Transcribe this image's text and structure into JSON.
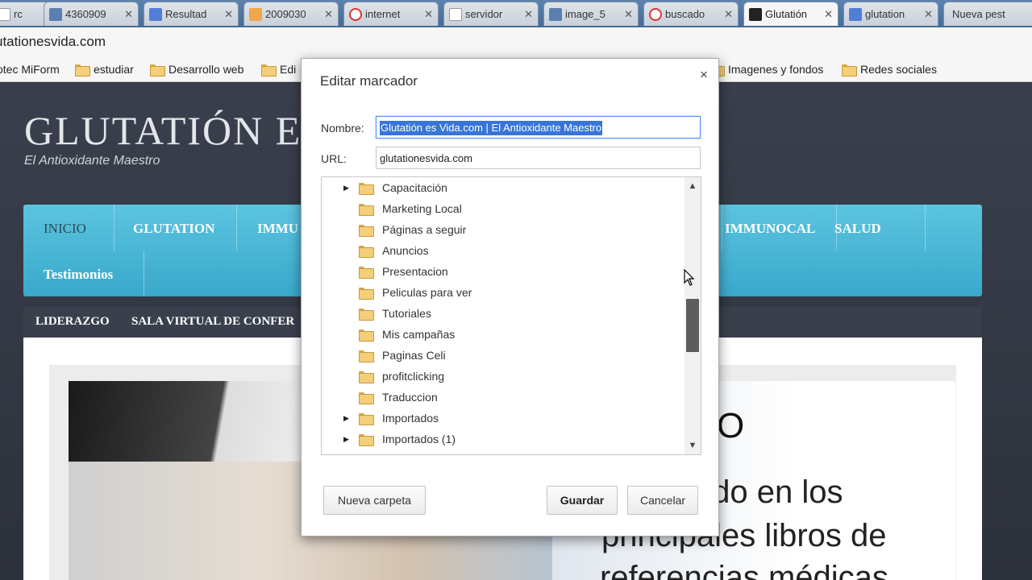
{
  "browser": {
    "tabs": [
      {
        "title": "rc",
        "icon": "page-icon",
        "active": false
      },
      {
        "title": "4360909",
        "icon": "image-icon",
        "active": false
      },
      {
        "title": "Resultad",
        "icon": "google-icon",
        "active": false
      },
      {
        "title": "2009030",
        "icon": "orange-folder-icon",
        "active": false
      },
      {
        "title": "internet",
        "icon": "red-circle-icon",
        "active": false
      },
      {
        "title": "servidor",
        "icon": "page-icon",
        "active": false
      },
      {
        "title": "image_5",
        "icon": "image-icon",
        "active": false
      },
      {
        "title": "buscado",
        "icon": "red-circle-icon",
        "active": false
      },
      {
        "title": "Glutatión",
        "icon": "g-site-icon",
        "active": true
      },
      {
        "title": "glutation",
        "icon": "google-icon",
        "active": false
      },
      {
        "title": "Nueva pest",
        "icon": "",
        "active": false
      }
    ],
    "url": "utationesvida.com"
  },
  "bookmarks_bar": {
    "items": [
      "otec MiForm",
      "estudiar",
      "Desarrollo web",
      "Edi",
      "Imagenes y fondos",
      "Redes sociales"
    ]
  },
  "site": {
    "title": "GLUTATIÓN E",
    "tagline": "El Antioxidante Maestro",
    "nav": [
      "INICIO",
      "GLUTATION",
      "IMMU",
      "IMMUNOCAL",
      "SALUD"
    ],
    "nav_row2": [
      "Testimonios"
    ],
    "subnav": [
      "LIDERAZGO",
      "SALA VIRTUAL DE CONFER"
    ],
    "hero_heading": "O",
    "hero_lines": [
      "uido en los",
      "principales libros de",
      "referencias médicas"
    ]
  },
  "dialog": {
    "title": "Editar marcador",
    "close_glyph": "×",
    "name_label": "Nombre:",
    "name_value": "Glutatión es Vida.com | El Antioxidante Maestro",
    "url_label": "URL:",
    "url_value": "glutationesvida.com",
    "folders": [
      {
        "label": "Capacitación",
        "expandable": true
      },
      {
        "label": "Marketing Local",
        "expandable": false
      },
      {
        "label": "Páginas a seguir",
        "expandable": false
      },
      {
        "label": "Anuncios",
        "expandable": false
      },
      {
        "label": "Presentacion",
        "expandable": false
      },
      {
        "label": "Peliculas para ver",
        "expandable": false
      },
      {
        "label": "Tutoriales",
        "expandable": false
      },
      {
        "label": "Mis campañas",
        "expandable": false
      },
      {
        "label": "Paginas Celi",
        "expandable": false
      },
      {
        "label": "profitclicking",
        "expandable": false
      },
      {
        "label": "Traduccion",
        "expandable": false
      },
      {
        "label": "Importados",
        "expandable": true
      },
      {
        "label": "Importados (1)",
        "expandable": true
      }
    ],
    "scroll_position": 0.55,
    "new_folder_label": "Nueva carpeta",
    "save_label": "Guardar",
    "cancel_label": "Cancelar"
  },
  "colors": {
    "accent_selection": "#3875d7",
    "nav_bar": "#3aa8cb",
    "tabstrip": "#4a6f9c"
  }
}
